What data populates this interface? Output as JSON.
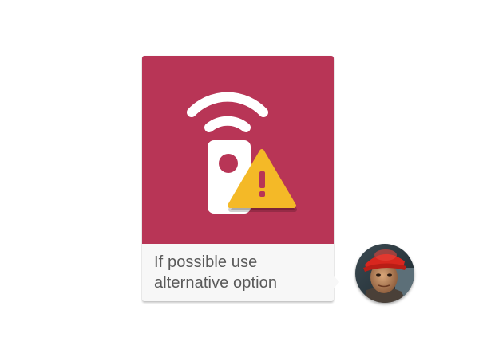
{
  "message": {
    "caption": "If possible use alternative option",
    "icon": "remote-wifi-warning-icon",
    "colors": {
      "hero_background": "#b83556",
      "icon_white": "#ffffff",
      "warning_yellow": "#f4b927",
      "caption_background": "#f7f7f7",
      "caption_text": "#5a5a5a"
    }
  },
  "sender": {
    "avatar": "user-avatar",
    "hat_color": "#d8261e"
  }
}
